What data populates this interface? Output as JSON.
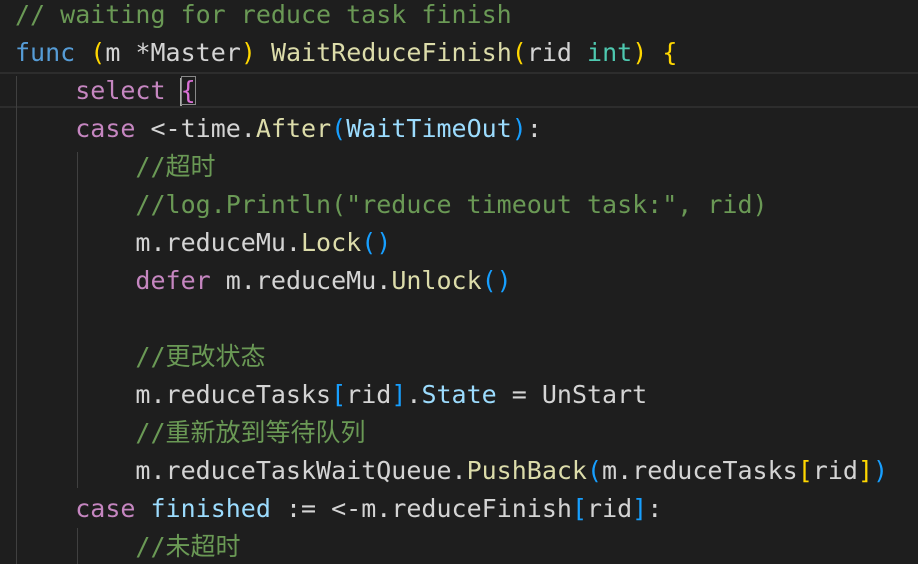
{
  "editor": {
    "language": "go",
    "colors": {
      "background": "#1e1e1e",
      "comment": "#6a9955",
      "keyword": "#569cd6",
      "control": "#c586c0",
      "function": "#dcdcaa",
      "type": "#4ec9b0",
      "property": "#9cdcfe",
      "text": "#d4d4d4",
      "bracket_level_1": "#ffd700",
      "bracket_level_2": "#da70d6",
      "bracket_level_3": "#179fff"
    },
    "lines": [
      [
        {
          "t": "// waiting for reduce task finish",
          "c": "comment"
        }
      ],
      [
        {
          "t": "func",
          "c": "kw"
        },
        {
          "t": " ",
          "c": "text"
        },
        {
          "t": "(",
          "c": "b1"
        },
        {
          "t": "m *Master",
          "c": "text"
        },
        {
          "t": ")",
          "c": "b1"
        },
        {
          "t": " ",
          "c": "text"
        },
        {
          "t": "WaitReduceFinish",
          "c": "fn"
        },
        {
          "t": "(",
          "c": "b1"
        },
        {
          "t": "rid ",
          "c": "text"
        },
        {
          "t": "int",
          "c": "type"
        },
        {
          "t": ")",
          "c": "b1"
        },
        {
          "t": " ",
          "c": "text"
        },
        {
          "t": "{",
          "c": "b1"
        }
      ],
      [
        {
          "t": "    ",
          "c": "text"
        },
        {
          "t": "select",
          "c": "ctrl"
        },
        {
          "t": " ",
          "c": "text"
        },
        {
          "t": "{",
          "c": "b2",
          "cursor": true
        }
      ],
      [
        {
          "t": "    ",
          "c": "text"
        },
        {
          "t": "case",
          "c": "ctrl"
        },
        {
          "t": " <-time.",
          "c": "text"
        },
        {
          "t": "After",
          "c": "fn"
        },
        {
          "t": "(",
          "c": "b3"
        },
        {
          "t": "WaitTimeOut",
          "c": "prop"
        },
        {
          "t": ")",
          "c": "b3"
        },
        {
          "t": ":",
          "c": "text"
        }
      ],
      [
        {
          "t": "        ",
          "c": "text"
        },
        {
          "t": "//超时",
          "c": "comment"
        }
      ],
      [
        {
          "t": "        ",
          "c": "text"
        },
        {
          "t": "//log.Println(\"reduce timeout task:\", rid)",
          "c": "comment"
        }
      ],
      [
        {
          "t": "        ",
          "c": "text"
        },
        {
          "t": "m.reduceMu.",
          "c": "text"
        },
        {
          "t": "Lock",
          "c": "fn"
        },
        {
          "t": "()",
          "c": "b3"
        }
      ],
      [
        {
          "t": "        ",
          "c": "text"
        },
        {
          "t": "defer",
          "c": "ctrl"
        },
        {
          "t": " m.reduceMu.",
          "c": "text"
        },
        {
          "t": "Unlock",
          "c": "fn"
        },
        {
          "t": "()",
          "c": "b3"
        }
      ],
      [],
      [
        {
          "t": "        ",
          "c": "text"
        },
        {
          "t": "//更改状态",
          "c": "comment"
        }
      ],
      [
        {
          "t": "        ",
          "c": "text"
        },
        {
          "t": "m.reduceTasks",
          "c": "text"
        },
        {
          "t": "[",
          "c": "b3"
        },
        {
          "t": "rid",
          "c": "text"
        },
        {
          "t": "]",
          "c": "b3"
        },
        {
          "t": ".",
          "c": "text"
        },
        {
          "t": "State",
          "c": "prop"
        },
        {
          "t": " = UnStart",
          "c": "text"
        }
      ],
      [
        {
          "t": "        ",
          "c": "text"
        },
        {
          "t": "//重新放到等待队列",
          "c": "comment"
        }
      ],
      [
        {
          "t": "        ",
          "c": "text"
        },
        {
          "t": "m.reduceTaskWaitQueue.",
          "c": "text"
        },
        {
          "t": "PushBack",
          "c": "fn"
        },
        {
          "t": "(",
          "c": "b3"
        },
        {
          "t": "m.reduceTasks",
          "c": "text"
        },
        {
          "t": "[",
          "c": "b1"
        },
        {
          "t": "rid",
          "c": "text"
        },
        {
          "t": "]",
          "c": "b1"
        },
        {
          "t": ")",
          "c": "b3"
        }
      ],
      [
        {
          "t": "    ",
          "c": "text"
        },
        {
          "t": "case",
          "c": "ctrl"
        },
        {
          "t": " ",
          "c": "text"
        },
        {
          "t": "finished",
          "c": "prop"
        },
        {
          "t": " := <-m.reduceFinish",
          "c": "text"
        },
        {
          "t": "[",
          "c": "b3"
        },
        {
          "t": "rid",
          "c": "text"
        },
        {
          "t": "]",
          "c": "b3"
        },
        {
          "t": ":",
          "c": "text"
        }
      ],
      [
        {
          "t": "        ",
          "c": "text"
        },
        {
          "t": "//未超时",
          "c": "comment"
        }
      ]
    ]
  }
}
